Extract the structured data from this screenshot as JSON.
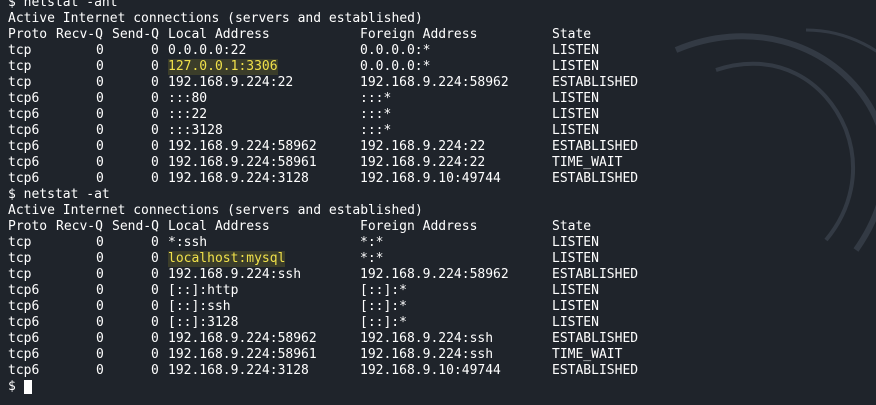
{
  "terminal": {
    "block1": {
      "command": "$ netstat -ant",
      "heading": "Active Internet connections (servers and established)",
      "columns": [
        "Proto",
        "Recv-Q",
        "Send-Q",
        "Local Address",
        "Foreign Address",
        "State"
      ],
      "rows": [
        {
          "proto": "tcp",
          "recv": "0",
          "send": "0",
          "local": "0.0.0.0:22",
          "foreign": "0.0.0.0:*",
          "state": "LISTEN",
          "highlight": false
        },
        {
          "proto": "tcp",
          "recv": "0",
          "send": "0",
          "local": "127.0.0.1:3306",
          "foreign": "0.0.0.0:*",
          "state": "LISTEN",
          "highlight": true
        },
        {
          "proto": "tcp",
          "recv": "0",
          "send": "0",
          "local": "192.168.9.224:22",
          "foreign": "192.168.9.224:58962",
          "state": "ESTABLISHED",
          "highlight": false
        },
        {
          "proto": "tcp6",
          "recv": "0",
          "send": "0",
          "local": ":::80",
          "foreign": ":::*",
          "state": "LISTEN",
          "highlight": false
        },
        {
          "proto": "tcp6",
          "recv": "0",
          "send": "0",
          "local": ":::22",
          "foreign": ":::*",
          "state": "LISTEN",
          "highlight": false
        },
        {
          "proto": "tcp6",
          "recv": "0",
          "send": "0",
          "local": ":::3128",
          "foreign": ":::*",
          "state": "LISTEN",
          "highlight": false
        },
        {
          "proto": "tcp6",
          "recv": "0",
          "send": "0",
          "local": "192.168.9.224:58962",
          "foreign": "192.168.9.224:22",
          "state": "ESTABLISHED",
          "highlight": false
        },
        {
          "proto": "tcp6",
          "recv": "0",
          "send": "0",
          "local": "192.168.9.224:58961",
          "foreign": "192.168.9.224:22",
          "state": "TIME_WAIT",
          "highlight": false
        },
        {
          "proto": "tcp6",
          "recv": "0",
          "send": "0",
          "local": "192.168.9.224:3128",
          "foreign": "192.168.9.10:49744",
          "state": "ESTABLISHED",
          "highlight": false
        }
      ]
    },
    "block2": {
      "command": "$ netstat -at",
      "heading": "Active Internet connections (servers and established)",
      "columns": [
        "Proto",
        "Recv-Q",
        "Send-Q",
        "Local Address",
        "Foreign Address",
        "State"
      ],
      "rows": [
        {
          "proto": "tcp",
          "recv": "0",
          "send": "0",
          "local": "*:ssh",
          "foreign": "*:*",
          "state": "LISTEN",
          "highlight": false
        },
        {
          "proto": "tcp",
          "recv": "0",
          "send": "0",
          "local": "localhost:mysql",
          "foreign": "*:*",
          "state": "LISTEN",
          "highlight": true
        },
        {
          "proto": "tcp",
          "recv": "0",
          "send": "0",
          "local": "192.168.9.224:ssh",
          "foreign": "192.168.9.224:58962",
          "state": "ESTABLISHED",
          "highlight": false
        },
        {
          "proto": "tcp6",
          "recv": "0",
          "send": "0",
          "local": "[::]:http",
          "foreign": "[::]:*",
          "state": "LISTEN",
          "highlight": false
        },
        {
          "proto": "tcp6",
          "recv": "0",
          "send": "0",
          "local": "[::]:ssh",
          "foreign": "[::]:*",
          "state": "LISTEN",
          "highlight": false
        },
        {
          "proto": "tcp6",
          "recv": "0",
          "send": "0",
          "local": "[::]:3128",
          "foreign": "[::]:*",
          "state": "LISTEN",
          "highlight": false
        },
        {
          "proto": "tcp6",
          "recv": "0",
          "send": "0",
          "local": "192.168.9.224:58962",
          "foreign": "192.168.9.224:ssh",
          "state": "ESTABLISHED",
          "highlight": false
        },
        {
          "proto": "tcp6",
          "recv": "0",
          "send": "0",
          "local": "192.168.9.224:58961",
          "foreign": "192.168.9.224:ssh",
          "state": "TIME_WAIT",
          "highlight": false
        },
        {
          "proto": "tcp6",
          "recv": "0",
          "send": "0",
          "local": "192.168.9.224:3128",
          "foreign": "192.168.9.10:49744",
          "state": "ESTABLISHED",
          "highlight": false
        }
      ]
    },
    "prompt": "$",
    "colors": {
      "background": "#1f242b",
      "text": "#ffffff",
      "highlight_bg": "#3b3d2a",
      "highlight_text": "#f0e14a"
    }
  }
}
